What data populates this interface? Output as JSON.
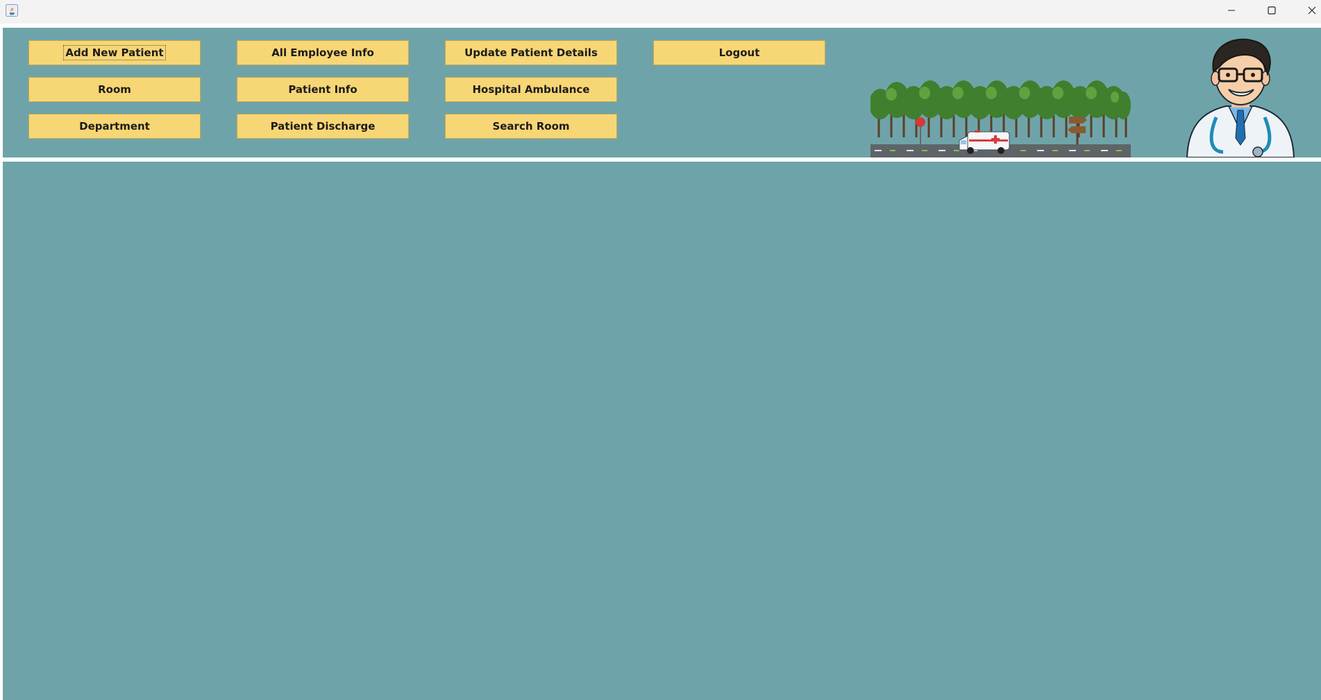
{
  "window": {
    "controls": {
      "minimize": "minimize-icon",
      "maximize": "maximize-icon",
      "close": "close-icon"
    }
  },
  "menu": {
    "buttons": [
      {
        "id": "add-new-patient",
        "label": "Add New Patient",
        "focused": true
      },
      {
        "id": "all-employee-info",
        "label": "All Employee Info"
      },
      {
        "id": "update-patient-details",
        "label": "Update Patient Details"
      },
      {
        "id": "logout",
        "label": "Logout"
      },
      {
        "id": "room",
        "label": "Room"
      },
      {
        "id": "patient-info",
        "label": "Patient Info"
      },
      {
        "id": "hospital-ambulance",
        "label": "Hospital Ambulance"
      },
      {
        "id": "department",
        "label": "Department"
      },
      {
        "id": "patient-discharge",
        "label": "Patient Discharge"
      },
      {
        "id": "search-room",
        "label": "Search Room"
      }
    ]
  },
  "images": {
    "road": "ambulance-road-illustration",
    "doctor": "doctor-avatar-illustration"
  },
  "colors": {
    "panel": "#6ea4a9",
    "button": "#f7d675",
    "button_border": "#c8a84e",
    "separator": "#ffffff"
  }
}
